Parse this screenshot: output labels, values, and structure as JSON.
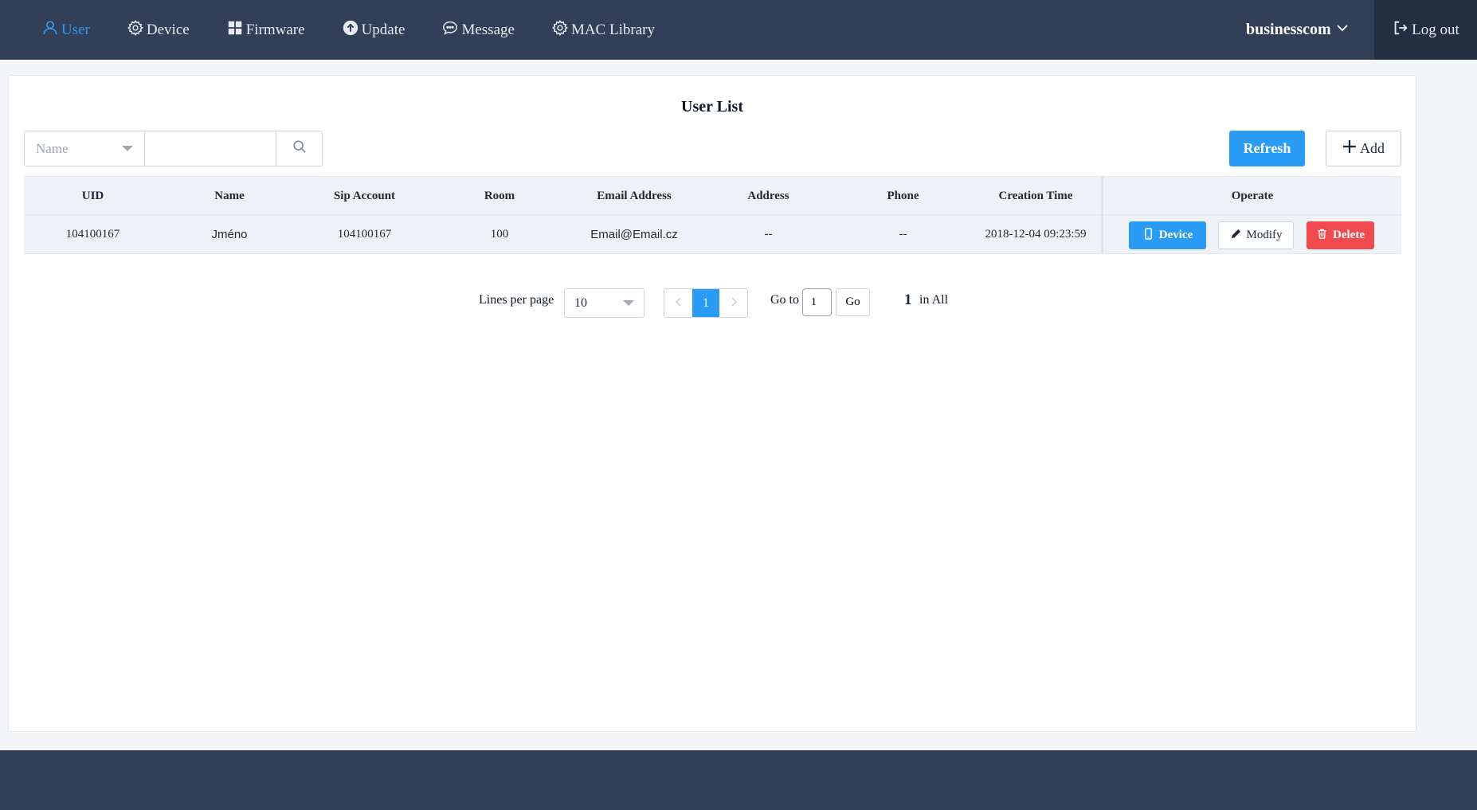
{
  "nav": {
    "items": [
      {
        "label": "User",
        "icon": "user-icon",
        "active": true
      },
      {
        "label": "Device",
        "icon": "gear-icon",
        "active": false
      },
      {
        "label": "Firmware",
        "icon": "grid-icon",
        "active": false
      },
      {
        "label": "Update",
        "icon": "upload-icon",
        "active": false
      },
      {
        "label": "Message",
        "icon": "chat-icon",
        "active": false
      },
      {
        "label": "MAC Library",
        "icon": "gear-icon",
        "active": false
      }
    ],
    "account": "businesscom",
    "logout": "Log out"
  },
  "colors": {
    "accent": "#2a9cf5",
    "header": "#323f56",
    "danger": "#f04a4e"
  },
  "page": {
    "title": "User List"
  },
  "search": {
    "field": "Name",
    "value": ""
  },
  "toolbar": {
    "refresh": "Refresh",
    "add": "Add"
  },
  "table": {
    "columns": [
      "UID",
      "Name",
      "Sip Account",
      "Room",
      "Email Address",
      "Address",
      "Phone",
      "Creation Time",
      "Operate"
    ],
    "rows": [
      {
        "uid": "104100167",
        "name": "Jméno",
        "sip": "104100167",
        "room": "100",
        "email": "Email@Email.cz",
        "address": "--",
        "phone": "--",
        "created": "2018-12-04 09:23:59"
      }
    ],
    "actions": {
      "device": "Device",
      "modify": "Modify",
      "delete": "Delete"
    }
  },
  "pagination": {
    "lines_label": "Lines per page",
    "lines_value": "10",
    "current_page": "1",
    "goto_label": "Go to",
    "goto_value": "1",
    "go": "Go",
    "total": "1",
    "total_suffix": "in All"
  }
}
